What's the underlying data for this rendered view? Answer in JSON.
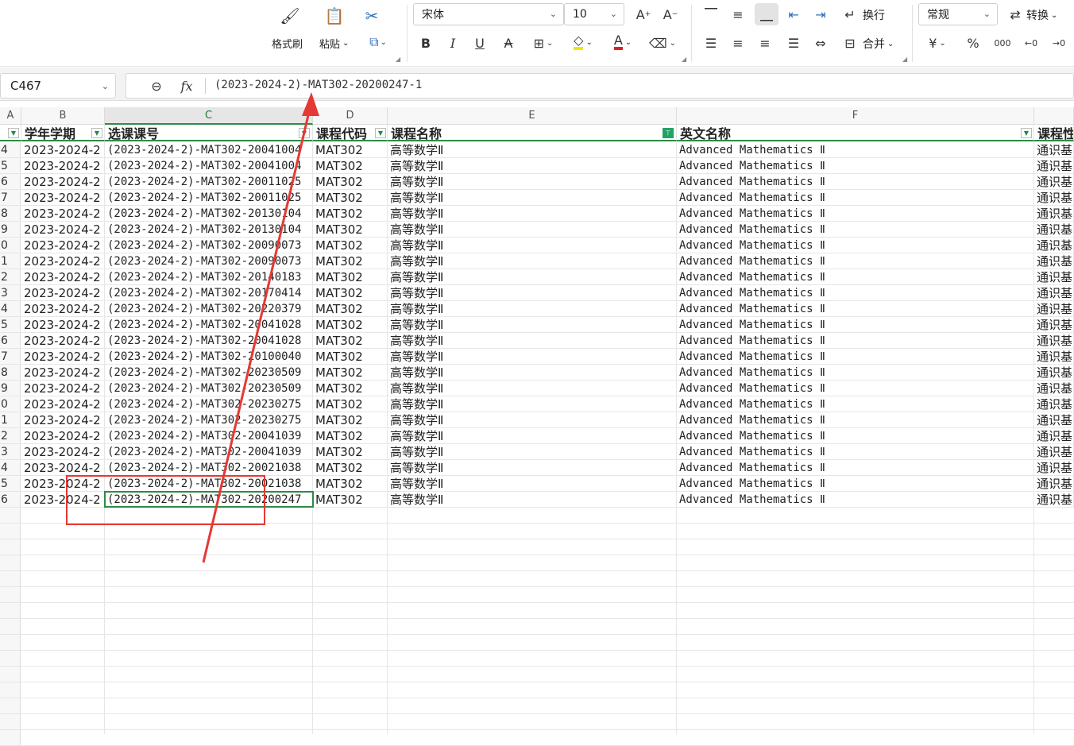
{
  "ribbon": {
    "format_painter": "格式刷",
    "paste": "粘贴",
    "font_name": "宋体",
    "font_size": "10",
    "wrap": "换行",
    "merge": "合并",
    "number_format": "常规",
    "convert": "转换"
  },
  "formula_bar": {
    "cell_ref": "C467",
    "fx": "fx",
    "content": "(2023-2024-2)-MAT302-20200247-1"
  },
  "columns": [
    {
      "letter": "A",
      "header": ""
    },
    {
      "letter": "B",
      "header": "学年学期"
    },
    {
      "letter": "C",
      "header": "选课课号"
    },
    {
      "letter": "D",
      "header": "课程代码"
    },
    {
      "letter": "E",
      "header": "课程名称"
    },
    {
      "letter": "F",
      "header": "英文名称"
    },
    {
      "letter": "",
      "header": "课程性"
    }
  ],
  "rows": [
    {
      "n": "4",
      "b": "2023-2024-2",
      "c": "(2023-2024-2)-MAT302-20041004",
      "d": "MAT302",
      "e": "高等数学Ⅱ",
      "f": "Advanced Mathematics Ⅱ",
      "g": "通识基"
    },
    {
      "n": "5",
      "b": "2023-2024-2",
      "c": "(2023-2024-2)-MAT302-20041004",
      "d": "MAT302",
      "e": "高等数学Ⅱ",
      "f": "Advanced Mathematics Ⅱ",
      "g": "通识基"
    },
    {
      "n": "6",
      "b": "2023-2024-2",
      "c": "(2023-2024-2)-MAT302-20011025",
      "d": "MAT302",
      "e": "高等数学Ⅱ",
      "f": "Advanced Mathematics Ⅱ",
      "g": "通识基"
    },
    {
      "n": "7",
      "b": "2023-2024-2",
      "c": "(2023-2024-2)-MAT302-20011025",
      "d": "MAT302",
      "e": "高等数学Ⅱ",
      "f": "Advanced Mathematics Ⅱ",
      "g": "通识基"
    },
    {
      "n": "8",
      "b": "2023-2024-2",
      "c": "(2023-2024-2)-MAT302-20130104",
      "d": "MAT302",
      "e": "高等数学Ⅱ",
      "f": "Advanced Mathematics Ⅱ",
      "g": "通识基"
    },
    {
      "n": "9",
      "b": "2023-2024-2",
      "c": "(2023-2024-2)-MAT302-20130104",
      "d": "MAT302",
      "e": "高等数学Ⅱ",
      "f": "Advanced Mathematics Ⅱ",
      "g": "通识基"
    },
    {
      "n": "0",
      "b": "2023-2024-2",
      "c": "(2023-2024-2)-MAT302-20090073",
      "d": "MAT302",
      "e": "高等数学Ⅱ",
      "f": "Advanced Mathematics Ⅱ",
      "g": "通识基"
    },
    {
      "n": "1",
      "b": "2023-2024-2",
      "c": "(2023-2024-2)-MAT302-20090073",
      "d": "MAT302",
      "e": "高等数学Ⅱ",
      "f": "Advanced Mathematics Ⅱ",
      "g": "通识基"
    },
    {
      "n": "2",
      "b": "2023-2024-2",
      "c": "(2023-2024-2)-MAT302-20140183",
      "d": "MAT302",
      "e": "高等数学Ⅱ",
      "f": "Advanced Mathematics Ⅱ",
      "g": "通识基"
    },
    {
      "n": "3",
      "b": "2023-2024-2",
      "c": "(2023-2024-2)-MAT302-20170414",
      "d": "MAT302",
      "e": "高等数学Ⅱ",
      "f": "Advanced Mathematics Ⅱ",
      "g": "通识基"
    },
    {
      "n": "4",
      "b": "2023-2024-2",
      "c": "(2023-2024-2)-MAT302-20220379",
      "d": "MAT302",
      "e": "高等数学Ⅱ",
      "f": "Advanced Mathematics Ⅱ",
      "g": "通识基"
    },
    {
      "n": "5",
      "b": "2023-2024-2",
      "c": "(2023-2024-2)-MAT302-20041028",
      "d": "MAT302",
      "e": "高等数学Ⅱ",
      "f": "Advanced Mathematics Ⅱ",
      "g": "通识基"
    },
    {
      "n": "6",
      "b": "2023-2024-2",
      "c": "(2023-2024-2)-MAT302-20041028",
      "d": "MAT302",
      "e": "高等数学Ⅱ",
      "f": "Advanced Mathematics Ⅱ",
      "g": "通识基"
    },
    {
      "n": "7",
      "b": "2023-2024-2",
      "c": "(2023-2024-2)-MAT302-20100040",
      "d": "MAT302",
      "e": "高等数学Ⅱ",
      "f": "Advanced Mathematics Ⅱ",
      "g": "通识基"
    },
    {
      "n": "8",
      "b": "2023-2024-2",
      "c": "(2023-2024-2)-MAT302-20230509",
      "d": "MAT302",
      "e": "高等数学Ⅱ",
      "f": "Advanced Mathematics Ⅱ",
      "g": "通识基"
    },
    {
      "n": "9",
      "b": "2023-2024-2",
      "c": "(2023-2024-2)-MAT302-20230509",
      "d": "MAT302",
      "e": "高等数学Ⅱ",
      "f": "Advanced Mathematics Ⅱ",
      "g": "通识基"
    },
    {
      "n": "0",
      "b": "2023-2024-2",
      "c": "(2023-2024-2)-MAT302-20230275",
      "d": "MAT302",
      "e": "高等数学Ⅱ",
      "f": "Advanced Mathematics Ⅱ",
      "g": "通识基"
    },
    {
      "n": "1",
      "b": "2023-2024-2",
      "c": "(2023-2024-2)-MAT302-20230275",
      "d": "MAT302",
      "e": "高等数学Ⅱ",
      "f": "Advanced Mathematics Ⅱ",
      "g": "通识基"
    },
    {
      "n": "2",
      "b": "2023-2024-2",
      "c": "(2023-2024-2)-MAT302-20041039",
      "d": "MAT302",
      "e": "高等数学Ⅱ",
      "f": "Advanced Mathematics Ⅱ",
      "g": "通识基"
    },
    {
      "n": "3",
      "b": "2023-2024-2",
      "c": "(2023-2024-2)-MAT302-20041039",
      "d": "MAT302",
      "e": "高等数学Ⅱ",
      "f": "Advanced Mathematics Ⅱ",
      "g": "通识基"
    },
    {
      "n": "4",
      "b": "2023-2024-2",
      "c": "(2023-2024-2)-MAT302-20021038",
      "d": "MAT302",
      "e": "高等数学Ⅱ",
      "f": "Advanced Mathematics Ⅱ",
      "g": "通识基"
    },
    {
      "n": "5",
      "b": "2023-2024-2",
      "c": "(2023-2024-2)-MAT302-20021038",
      "d": "MAT302",
      "e": "高等数学Ⅱ",
      "f": "Advanced Mathematics Ⅱ",
      "g": "通识基"
    },
    {
      "n": "6",
      "b": "2023-2024-2",
      "c": "(2023-2024-2)-MAT302-20200247",
      "d": "MAT302",
      "e": "高等数学Ⅱ",
      "f": "Advanced Mathematics Ⅱ",
      "g": "通识基"
    }
  ],
  "colors": {
    "accent_green": "#2e8b45",
    "annotation_red": "#e53935",
    "filter_active": "#21a366"
  }
}
